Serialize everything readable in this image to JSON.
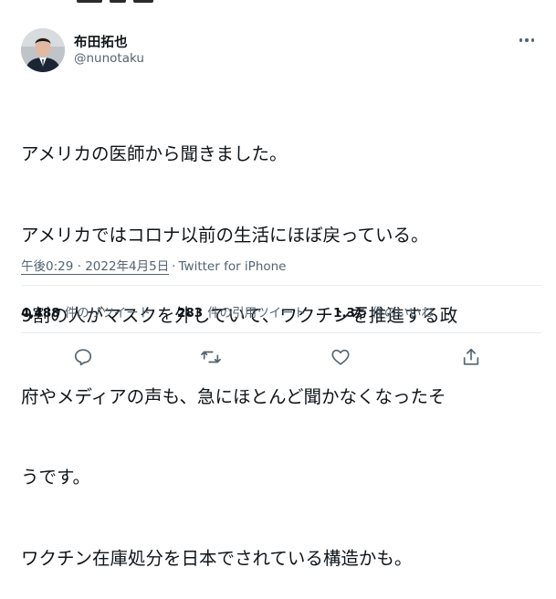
{
  "tweet": {
    "display_name": "布田拓也",
    "handle": "@nunotaku",
    "lines": [
      "アメリカの医師から聞きました。",
      "アメリカではコロナ以前の生活にほぼ戻っている。",
      "9割の人がマスクを外していて、ワクチンを推進する政",
      "府やメディアの声も、急にほとんど聞かなくなったそ",
      "うです。",
      "ワクチン在庫処分を日本でされている構造かも。"
    ],
    "time": "午後0:29 · 2022年4月5日",
    "separator": "·",
    "source": "Twitter for iPhone"
  },
  "stats": {
    "retweets": {
      "count": "4,488",
      "label": "件のリツイート"
    },
    "quotes": {
      "count": "283",
      "label": "件の引用ツイート"
    },
    "likes": {
      "count": "1.3万",
      "label": "件のいいね"
    }
  },
  "actions": [
    "reply-icon",
    "retweet-icon",
    "like-icon",
    "share-icon"
  ],
  "colors": {
    "text": "#0f1419",
    "secondary": "#536471",
    "divider": "#e6ecf0"
  }
}
